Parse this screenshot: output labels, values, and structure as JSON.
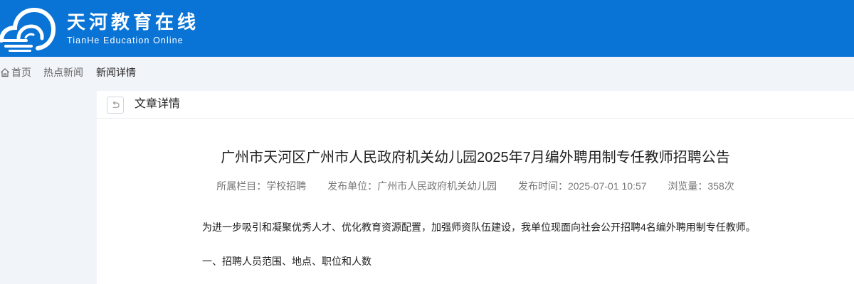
{
  "header": {
    "logo_cn": "天河教育在线",
    "logo_en": "TianHe Education Online",
    "bg_color": "#0a74d6"
  },
  "breadcrumb": {
    "icon": "home-icon",
    "items": [
      "首页",
      "热点新闻",
      "新闻详情"
    ]
  },
  "panel": {
    "back_icon": "back-arrow-icon",
    "title": "文章详情"
  },
  "article": {
    "title": "广州市天河区广州市人民政府机关幼儿园2025年7月编外聘用制专任教师招聘公告",
    "meta": {
      "column": "所属栏目：学校招聘",
      "publisher": "发布单位：广州市人民政府机关幼儿园",
      "time": "发布时间：2025-07-01 10:57",
      "views": "浏览量：358次"
    },
    "paragraphs": [
      "为进一步吸引和凝聚优秀人才、优化教育资源配置，加强师资队伍建设，我单位现面向社会公开招聘4名编外聘用制专任教师。",
      "一、招聘人员范围、地点、职位和人数"
    ]
  }
}
